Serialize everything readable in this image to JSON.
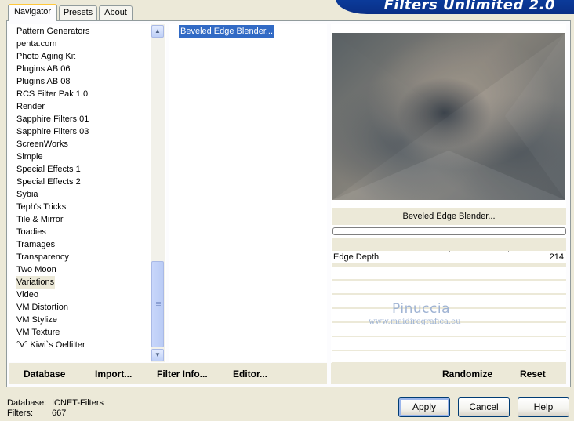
{
  "app": {
    "title": "Filters Unlimited 2.0"
  },
  "tabs": [
    {
      "label": "Navigator",
      "active": true
    },
    {
      "label": "Presets",
      "active": false
    },
    {
      "label": "About",
      "active": false
    }
  ],
  "categories": [
    "Pattern Generators",
    "penta.com",
    "Photo Aging Kit",
    "Plugins AB 06",
    "Plugins AB 08",
    "RCS Filter Pak 1.0",
    "Render",
    "Sapphire Filters 01",
    "Sapphire Filters 03",
    "ScreenWorks",
    "Simple",
    "Special Effects 1",
    "Special Effects 2",
    "Sybia",
    "Teph's Tricks",
    "Tile & Mirror",
    "Toadies",
    "Tramages",
    "Transparency",
    "Two Moon",
    "Variations",
    "Video",
    "VM Distortion",
    "VM Stylize",
    "VM Texture",
    "°v° Kiwi`s Oelfilter"
  ],
  "selected_category": "Variations",
  "filters": [
    "Beveled Edge Blender..."
  ],
  "selected_filter": "Beveled Edge Blender...",
  "filter_name_display": "Beveled Edge Blender...",
  "params": [
    {
      "label": "Edge Depth",
      "value": "214"
    }
  ],
  "watermark": {
    "name": "Pinuccia",
    "url": "www.maidiregrafica.eu"
  },
  "left_buttons": {
    "database": "Database",
    "import": "Import...",
    "filter_info": "Filter Info...",
    "editor": "Editor..."
  },
  "right_buttons": {
    "randomize": "Randomize",
    "reset": "Reset"
  },
  "footer": {
    "database_label": "Database:",
    "database_value": "ICNET-Filters",
    "filters_label": "Filters:",
    "filters_value": "667"
  },
  "dialog_buttons": {
    "apply": "Apply",
    "cancel": "Cancel",
    "help": "Help"
  },
  "colors": {
    "selection": "#316AC5",
    "banner": "#0B3C9C",
    "face": "#ECE9D8"
  }
}
